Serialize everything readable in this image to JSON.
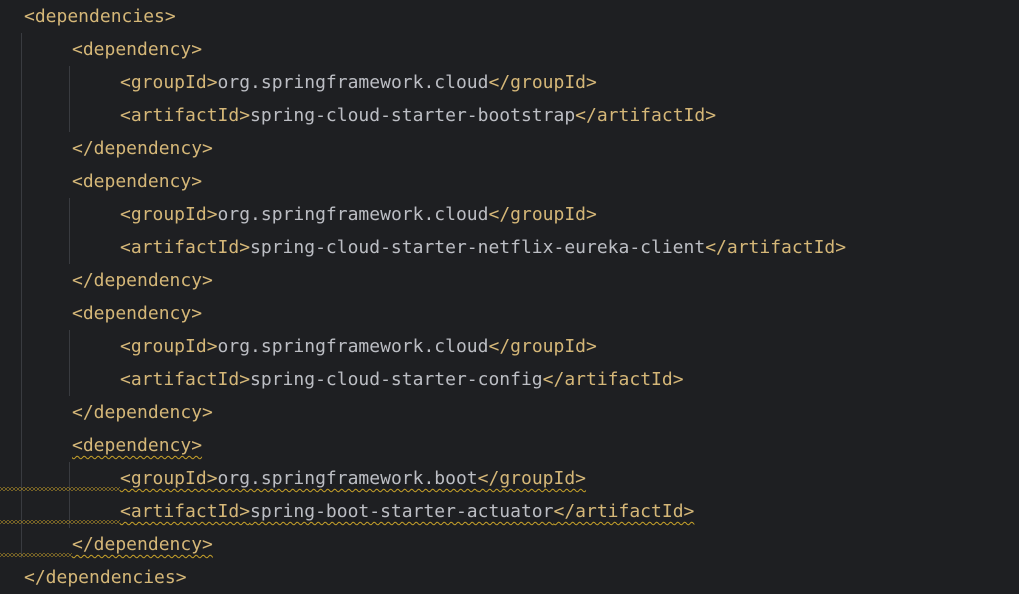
{
  "lines": [
    {
      "indent": 0,
      "open": "<dependencies>"
    },
    {
      "indent": 1,
      "open": "<dependency>"
    },
    {
      "indent": 2,
      "open": "<groupId>",
      "text": "org.springframework.cloud",
      "close": "</groupId>"
    },
    {
      "indent": 2,
      "open": "<artifactId>",
      "text": "spring-cloud-starter-bootstrap",
      "close": "</artifactId>"
    },
    {
      "indent": 1,
      "open": "</dependency>"
    },
    {
      "indent": 1,
      "open": "<dependency>"
    },
    {
      "indent": 2,
      "open": "<groupId>",
      "text": "org.springframework.cloud",
      "close": "</groupId>"
    },
    {
      "indent": 2,
      "open": "<artifactId>",
      "text": "spring-cloud-starter-netflix-eureka-client",
      "close": "</artifactId>"
    },
    {
      "indent": 1,
      "open": "</dependency>"
    },
    {
      "indent": 1,
      "open": "<dependency>"
    },
    {
      "indent": 2,
      "open": "<groupId>",
      "text": "org.springframework.cloud",
      "close": "</groupId>"
    },
    {
      "indent": 2,
      "open": "<artifactId>",
      "text": "spring-cloud-starter-config",
      "close": "</artifactId>"
    },
    {
      "indent": 1,
      "open": "</dependency>"
    },
    {
      "indent": 1,
      "open": "<dependency>",
      "warn": true
    },
    {
      "indent": 2,
      "open": "<groupId>",
      "text": "org.springframework.boot",
      "close": "</groupId>",
      "warn": true
    },
    {
      "indent": 2,
      "open": "<artifactId>",
      "text": "spring-boot-starter-actuator",
      "close": "</artifactId>",
      "warn": true
    },
    {
      "indent": 1,
      "open": "</dependency>",
      "warn": true
    },
    {
      "indent": 0,
      "open": "</dependencies>"
    }
  ],
  "colors": {
    "background": "#1e1f22",
    "tag": "#d5b778",
    "text": "#bcbec4",
    "warning": "#c9a32a",
    "guide": "#393b40"
  }
}
